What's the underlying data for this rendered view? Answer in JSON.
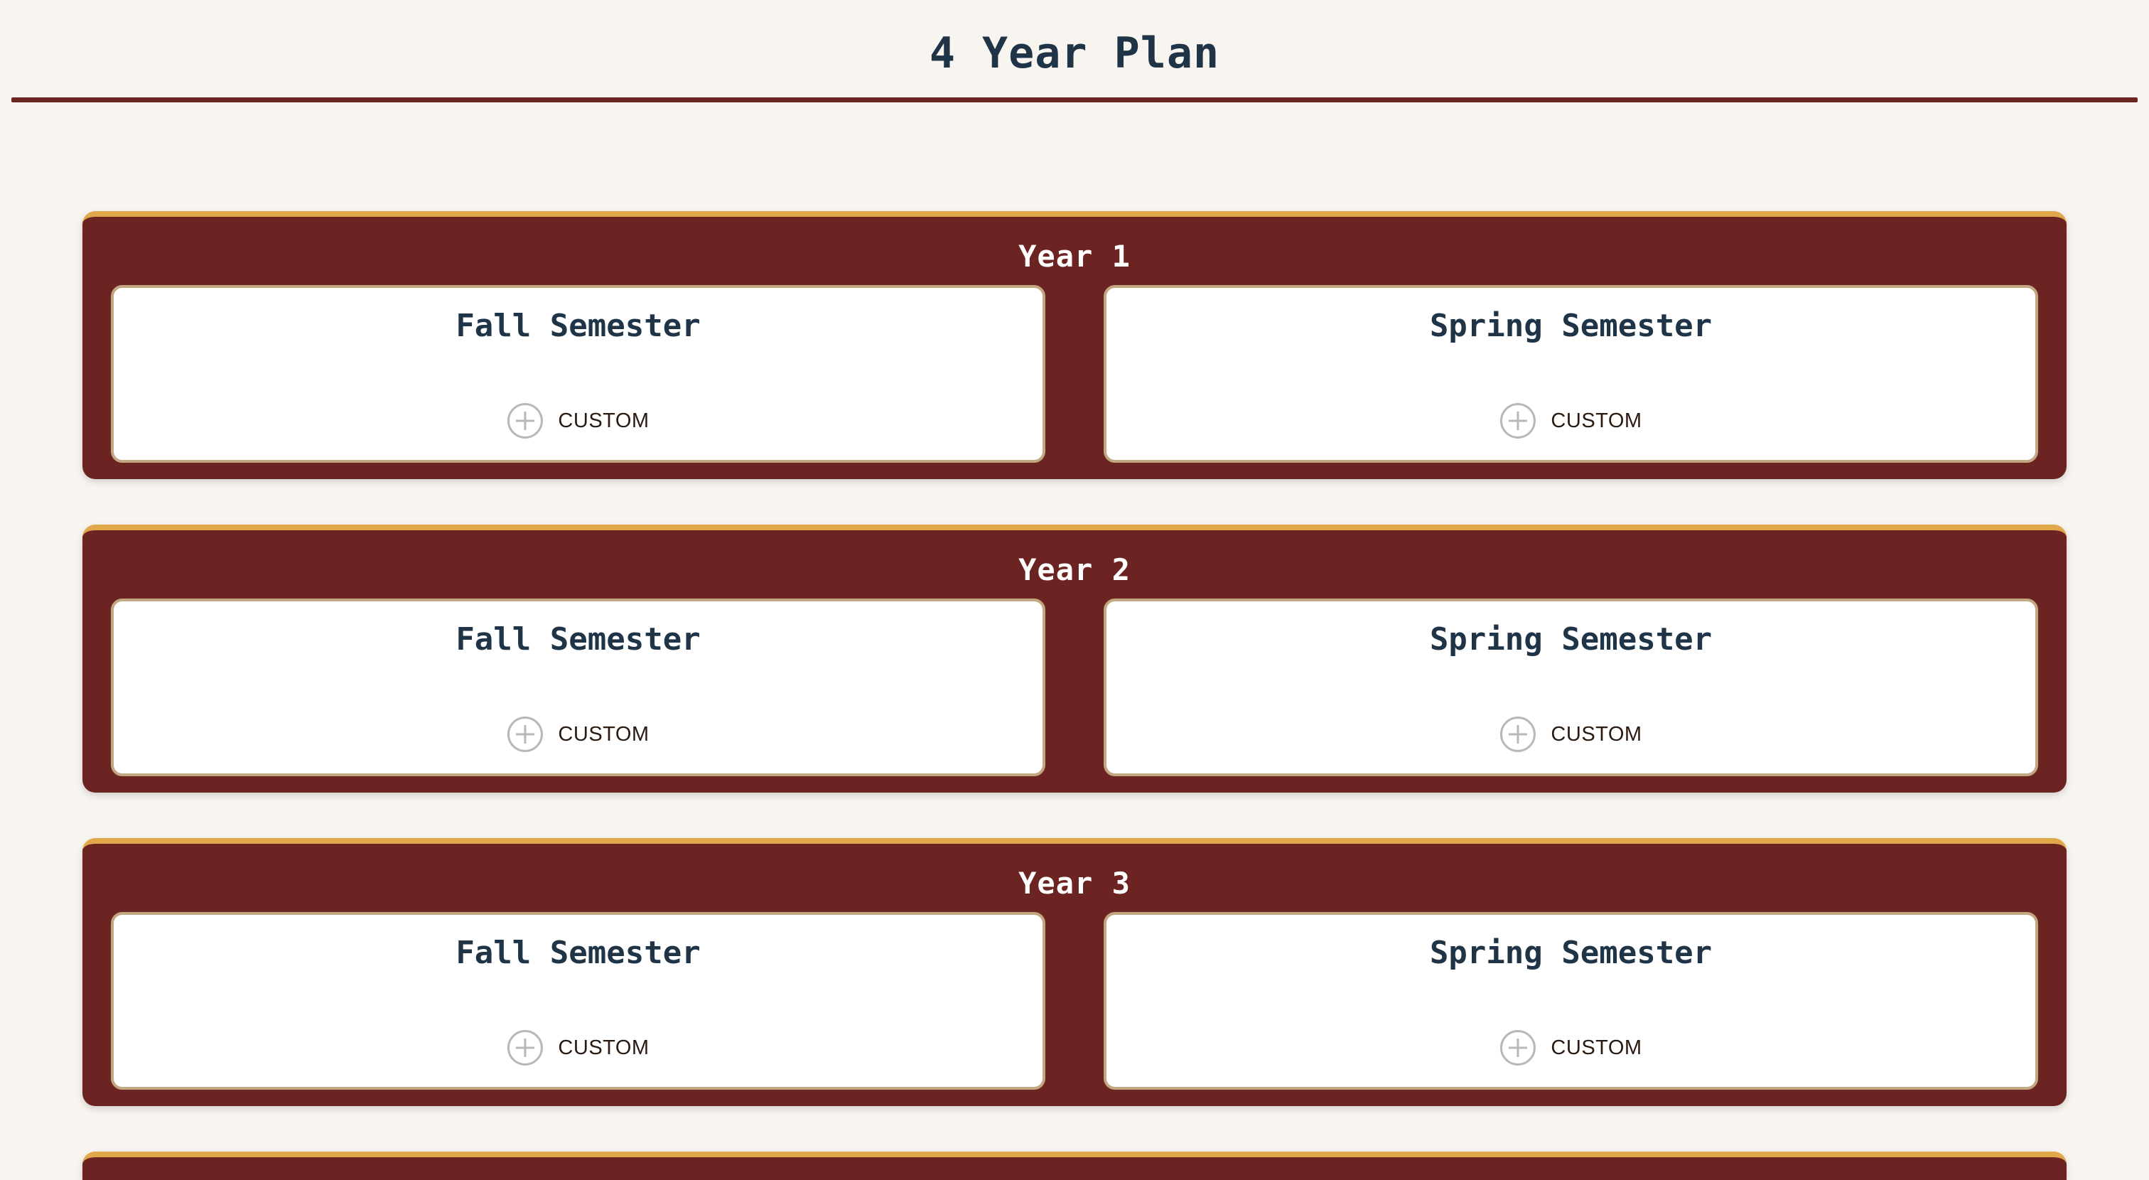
{
  "page": {
    "title": "4 Year Plan"
  },
  "years": [
    {
      "title": "Year 1",
      "semesters": [
        {
          "title": "Fall Semester",
          "button_label": "CUSTOM"
        },
        {
          "title": "Spring Semester",
          "button_label": "CUSTOM"
        }
      ]
    },
    {
      "title": "Year 2",
      "semesters": [
        {
          "title": "Fall Semester",
          "button_label": "CUSTOM"
        },
        {
          "title": "Spring Semester",
          "button_label": "CUSTOM"
        }
      ]
    },
    {
      "title": "Year 3",
      "semesters": [
        {
          "title": "Fall Semester",
          "button_label": "CUSTOM"
        },
        {
          "title": "Spring Semester",
          "button_label": "CUSTOM"
        }
      ]
    }
  ],
  "icons": {
    "add": "plus-circle-icon"
  },
  "colors": {
    "background": "#f8f5f0",
    "card": "#6b2421",
    "card_top_border": "#e0a84a",
    "title_text": "#1f3447",
    "semester_border": "#c2a882"
  }
}
